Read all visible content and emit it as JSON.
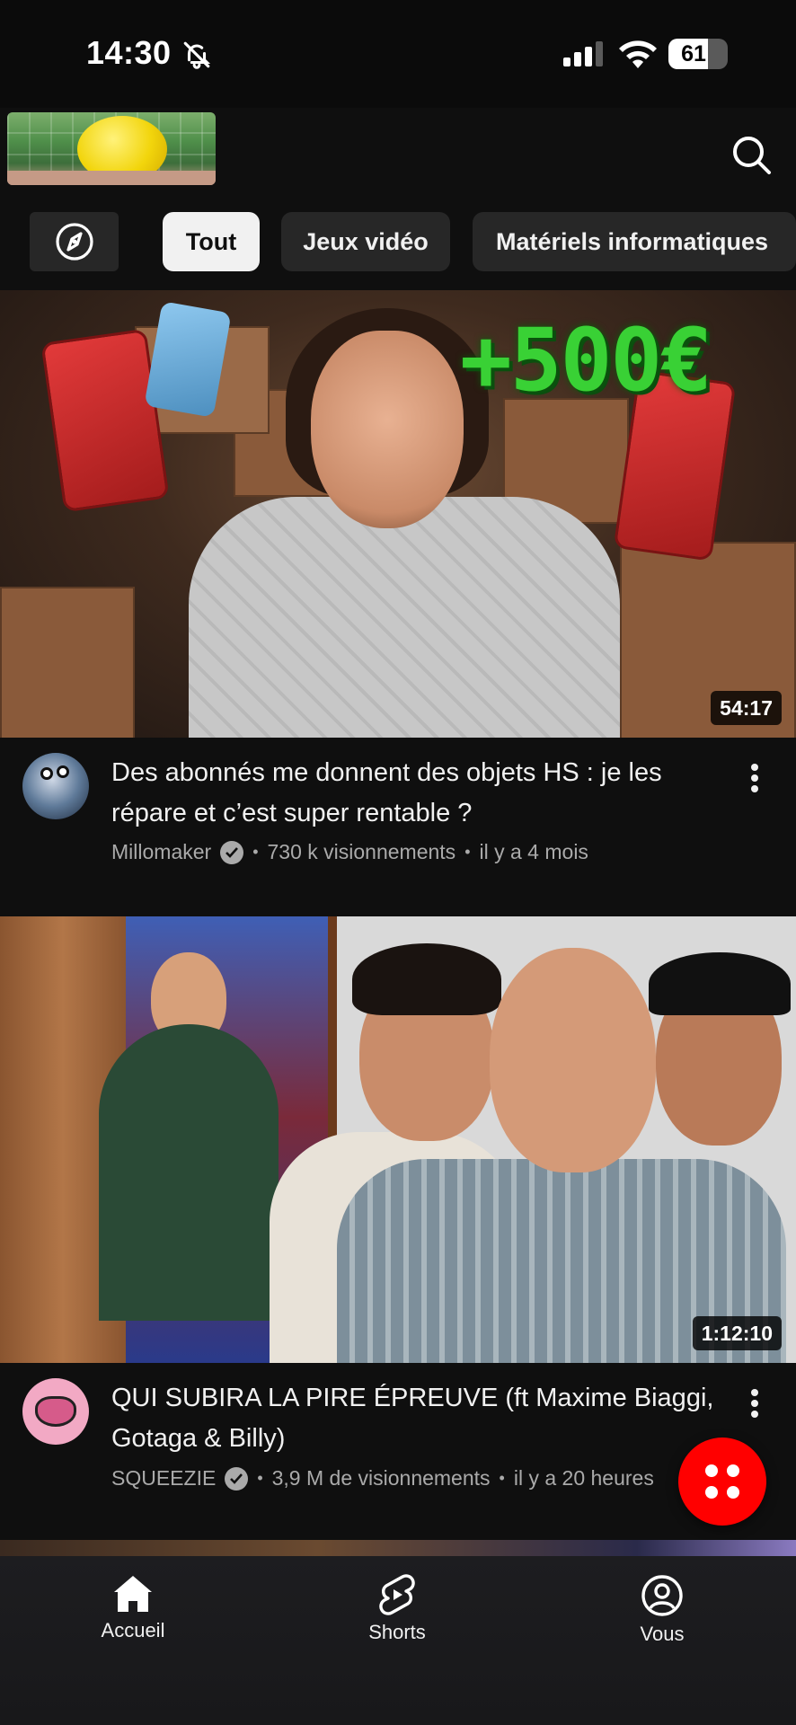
{
  "status_bar": {
    "time": "14:30",
    "battery": "61"
  },
  "chips": {
    "explore_icon": "compass-icon",
    "items": [
      {
        "label": "Tout",
        "active": true
      },
      {
        "label": "Jeux vidéo",
        "active": false
      },
      {
        "label": "Matériels informatiques",
        "active": false
      }
    ]
  },
  "videos": [
    {
      "title": "Des abonnés me donnent des objets HS : je les répare et c’est super rentable ?",
      "channel": "Millomaker",
      "views": "730 k visionnements",
      "age": "il y a 4 mois",
      "duration": "54:17",
      "overlay_text": "+500€"
    },
    {
      "title": "QUI SUBIRA LA PIRE ÉPREUVE (ft Maxime Biaggi, Gotaga & Billy)",
      "channel": "SQUEEZIE",
      "views": "3,9 M de visionnements",
      "age": "il y a 20 heures",
      "duration": "1:12:10"
    }
  ],
  "bottom_nav": {
    "home": "Accueil",
    "shorts": "Shorts",
    "you": "Vous"
  },
  "colors": {
    "background": "#0f0f0f",
    "accent_red": "#ff0000",
    "chip": "#272727",
    "secondary_text": "#aaaaaa"
  }
}
